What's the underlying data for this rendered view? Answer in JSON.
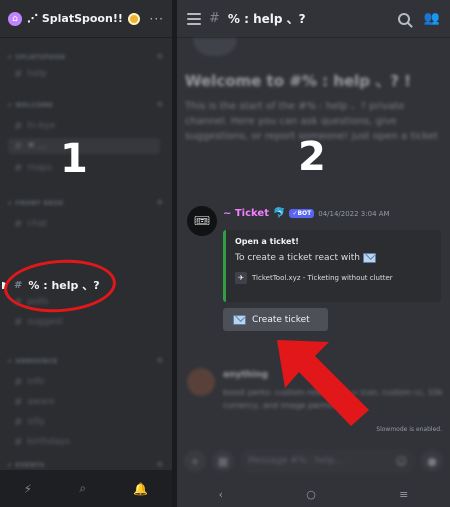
{
  "server": {
    "name": "⋰ SplatSpoon!!",
    "more": "···"
  },
  "categories": [
    {
      "label": "SPLATSPOON"
    },
    {
      "label": "WELCOME"
    },
    {
      "label": "FRONT DESK"
    },
    {
      "label": "ANNOUNCE"
    },
    {
      "label": "EVENTS"
    }
  ],
  "channels": [
    {
      "name": "help"
    },
    {
      "name": "hi-bye"
    },
    {
      "name": "✕ ..."
    },
    {
      "name": "maps"
    },
    {
      "name": "chat"
    },
    {
      "name": "polls"
    },
    {
      "name": "suggest"
    },
    {
      "name": "info"
    },
    {
      "name": "aware"
    },
    {
      "name": "silly"
    },
    {
      "name": "birthdays"
    }
  ],
  "active_channel": {
    "label": "% : help 、?"
  },
  "annotations": {
    "one": "1",
    "two": "2"
  },
  "topbar": {
    "title": "% : help 、?"
  },
  "welcome": {
    "title": "Welcome to #% : help 、? !",
    "text": "This is the start of the #% : help 、? private channel. Here you can ask questions, give suggestions, or report someone! just open a ticket"
  },
  "message": {
    "author": "~ Ticket",
    "bot_tag": "✓BOT",
    "time": "04/14/2022 3:04 AM",
    "embed": {
      "title": "Open a ticket!",
      "description": "To create a ticket react with",
      "footer": "TicketTool.xyz - Ticketing without clutter"
    },
    "button": "Create ticket"
  },
  "blurred_message": {
    "author": "anything",
    "text": "boost perks: custom role + hex = icon, custom cc, 10k currency, and image perms listed"
  },
  "notice": "Slowmode is enabled.",
  "input": {
    "placeholder": "Message #% : help..."
  },
  "colors": {
    "annotation_red": "#e2171a",
    "bot_name": "#f47fff",
    "embed_bar": "#2ea043",
    "bot_tag": "#5865f2"
  }
}
